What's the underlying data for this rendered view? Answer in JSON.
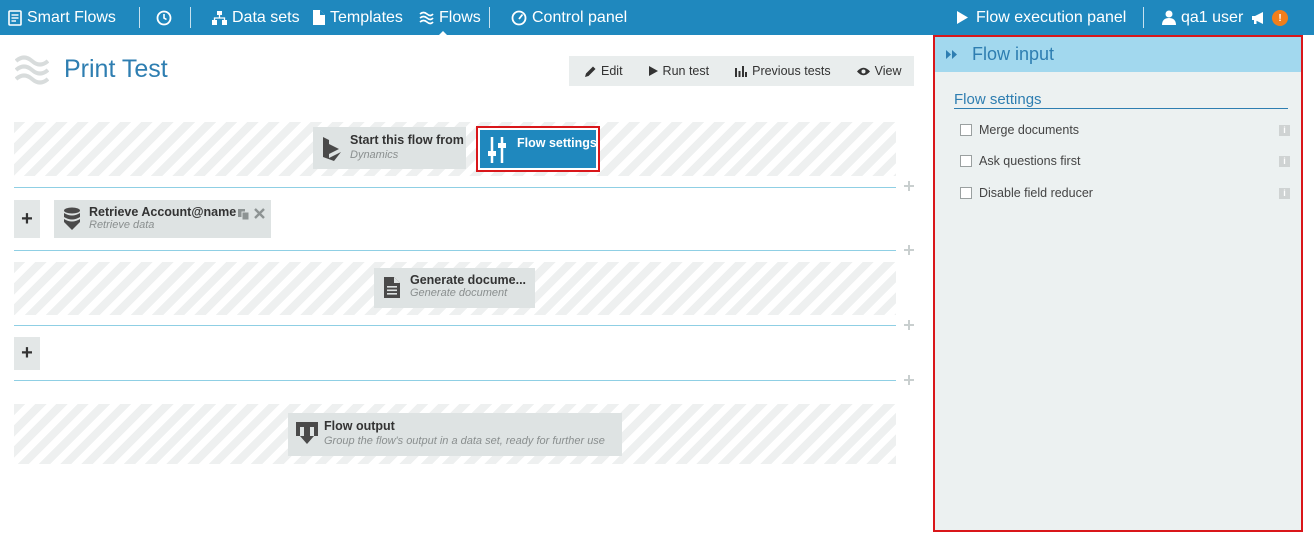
{
  "topbar": {
    "app_name": "Smart Flows",
    "nav": [
      {
        "label": "Data sets",
        "icon": "sitemap-icon"
      },
      {
        "label": "Templates",
        "icon": "file-icon"
      },
      {
        "label": "Flows",
        "icon": "waves-icon"
      }
    ],
    "control_panel": "Control panel",
    "flow_execution_panel": "Flow execution panel",
    "user": "qa1 user",
    "notification_badge": "!"
  },
  "page": {
    "title": "Print Test",
    "toolbar": {
      "edit": "Edit",
      "run_test": "Run test",
      "previous_tests": "Previous tests",
      "view": "View"
    }
  },
  "flow": {
    "start": {
      "title": "Start this flow from",
      "subtitle": "Dynamics"
    },
    "settings": {
      "title": "Flow settings"
    },
    "retrieve": {
      "title": "Retrieve Account@name",
      "subtitle": "Retrieve data"
    },
    "generate": {
      "title": "Generate docume...",
      "subtitle": "Generate document"
    },
    "output": {
      "title": "Flow output",
      "subtitle": "Group the flow's output in a data set, ready for further use"
    },
    "add_label": "+"
  },
  "panel": {
    "title": "Flow input",
    "section": "Flow settings",
    "settings": [
      {
        "label": "Merge documents",
        "checked": false
      },
      {
        "label": "Ask questions first",
        "checked": false
      },
      {
        "label": "Disable field reducer",
        "checked": false
      }
    ]
  },
  "colors": {
    "topbar": "#1f88be",
    "accent_text": "#2e7eb1",
    "panel_header": "#a2d8ee",
    "panel_bg": "#ecf1f1",
    "highlight_border": "#d9161a",
    "badge": "#f07e1b"
  }
}
